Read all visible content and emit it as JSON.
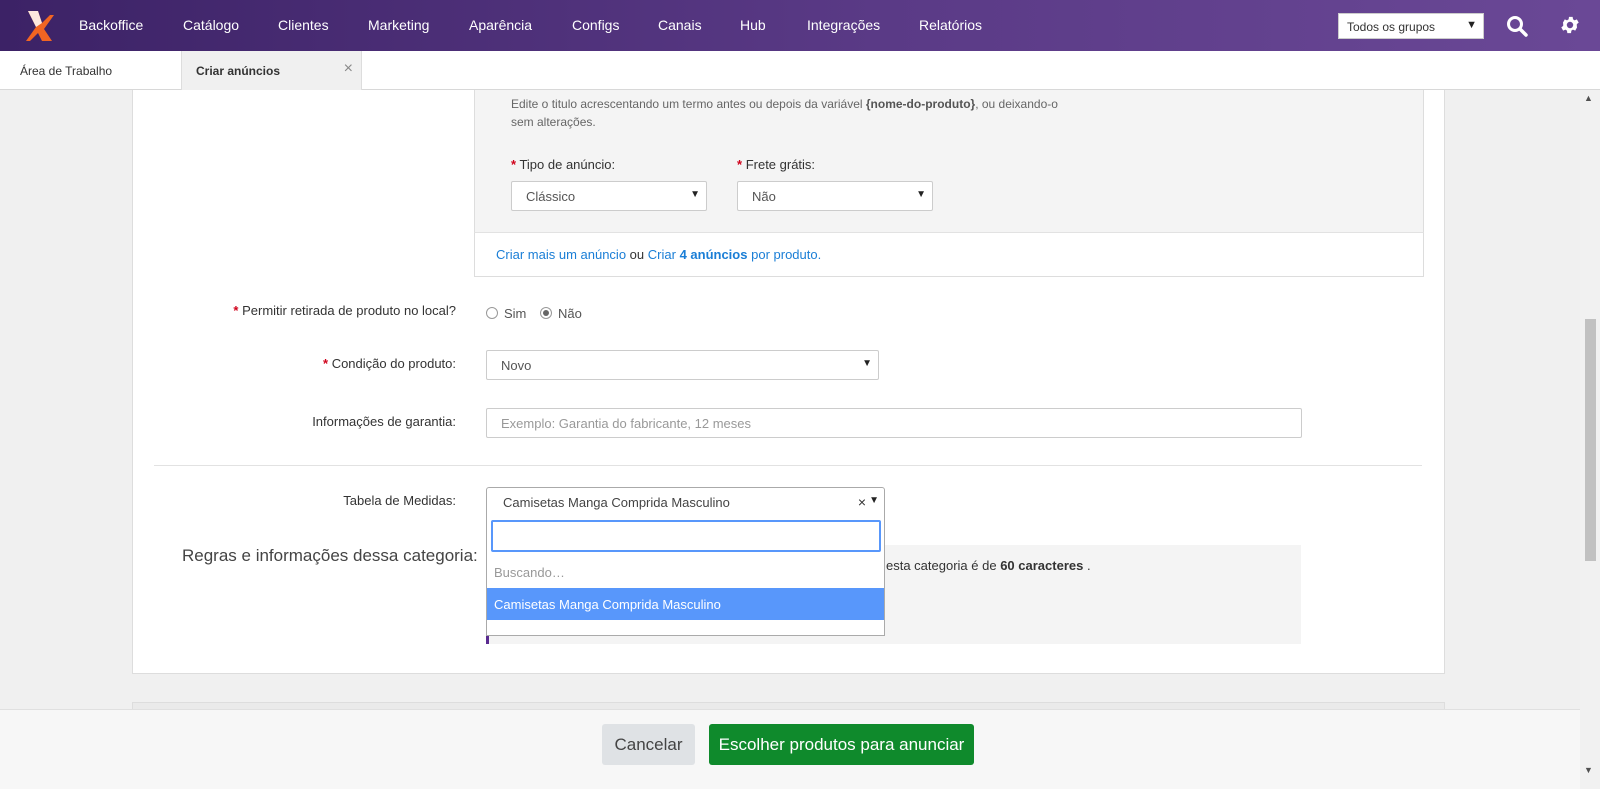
{
  "nav": {
    "items": [
      "Backoffice",
      "Catálogo",
      "Clientes",
      "Marketing",
      "Aparência",
      "Configs",
      "Canais",
      "Hub",
      "Integrações",
      "Relatórios"
    ],
    "group_select": "Todos os grupos"
  },
  "tabs": {
    "home": "Área de Trabalho",
    "active": "Criar anúncios",
    "close_glyph": "×"
  },
  "variant": {
    "hint_before": "Edite o titulo acrescentando um termo antes ou depois da variável ",
    "hint_var": "{nome-do-produto}",
    "hint_after": ", ou deixando-o sem alterações.",
    "tipo_label": "Tipo de anúncio:",
    "tipo_value": "Clássico",
    "frete_label": "Frete grátis:",
    "frete_value": "Não",
    "link_more": "Criar mais um anúncio",
    "or": "ou",
    "link_create": "Criar",
    "link_count": "4 anúncios",
    "link_suffix": "por produto."
  },
  "form": {
    "retirada_label": "Permitir retirada de produto no local?",
    "retirada_options": [
      "Sim",
      "Não"
    ],
    "retirada_selected": "Não",
    "condicao_label": "Condição do produto:",
    "condicao_value": "Novo",
    "garantia_label": "Informações de garantia:",
    "garantia_placeholder": "Exemplo: Garantia do fabricante, 12 meses",
    "tabela_label": "Tabela de Medidas:",
    "tabela_value": "Camisetas Manga Comprida Masculino",
    "rules_label": "Regras e informações dessa categoria:",
    "rules_text_before": "esta categoria é de ",
    "rules_text_bold": "60 caracteres",
    "rules_text_after": " ."
  },
  "dropdown": {
    "searching": "Buscando…",
    "options": [
      "Camisetas Manga Comprida Masculino"
    ],
    "clear_glyph": "×"
  },
  "footer": {
    "cancel": "Cancelar",
    "primary": "Escolher produtos para anunciar"
  },
  "colors": {
    "nav_gradient_start": "#3c2266",
    "nav_gradient_end": "#6a4896",
    "link": "#1a7ed6",
    "primary_button": "#0f8a2c",
    "highlight_option": "#5897fb",
    "required": "#d0021b"
  }
}
